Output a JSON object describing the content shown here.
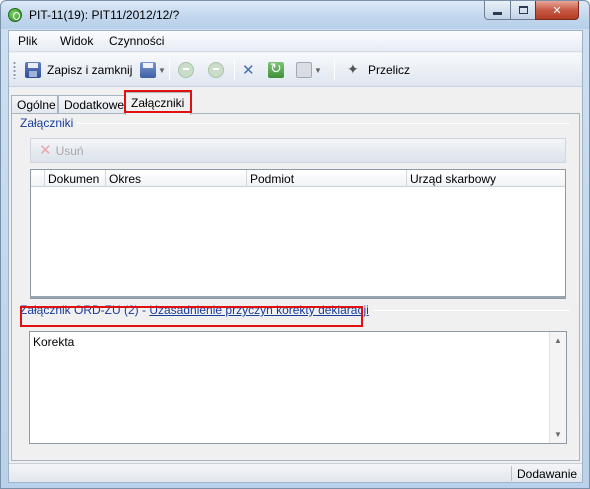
{
  "window": {
    "title": "PIT-11(19): PIT11/2012/12/?"
  },
  "menu": {
    "items": [
      {
        "label": "Plik"
      },
      {
        "label": "Widok"
      },
      {
        "label": "Czynności"
      }
    ]
  },
  "toolbar": {
    "save_close_label": "Zapisz i zamknij",
    "recalc_label": "Przelicz",
    "icons": [
      "save-close-icon",
      "save-icon",
      "back-icon",
      "forward-icon",
      "tools-icon",
      "refresh-icon",
      "print-icon",
      "wand-icon"
    ]
  },
  "tabs": [
    {
      "label": "Ogólne",
      "active": false
    },
    {
      "label": "Dodatkowe",
      "active": false
    },
    {
      "label": "Załączniki",
      "active": true
    }
  ],
  "attachments": {
    "group_title": "Załączniki",
    "delete_label": "Usuń",
    "columns": [
      "Dokumen",
      "Okres",
      "Podmiot",
      "Urząd skarbowy"
    ],
    "rows": []
  },
  "ordzu": {
    "group_title_prefix": "Załącznik ORD-ZU (2) - ",
    "group_title_link": "Uzasadnienie przyczyn korekty deklaracji",
    "text": "Korekta"
  },
  "status": {
    "mode": "Dodawanie"
  },
  "colors": {
    "highlight_border": "#e01010",
    "group_title": "#1a3c9a"
  }
}
